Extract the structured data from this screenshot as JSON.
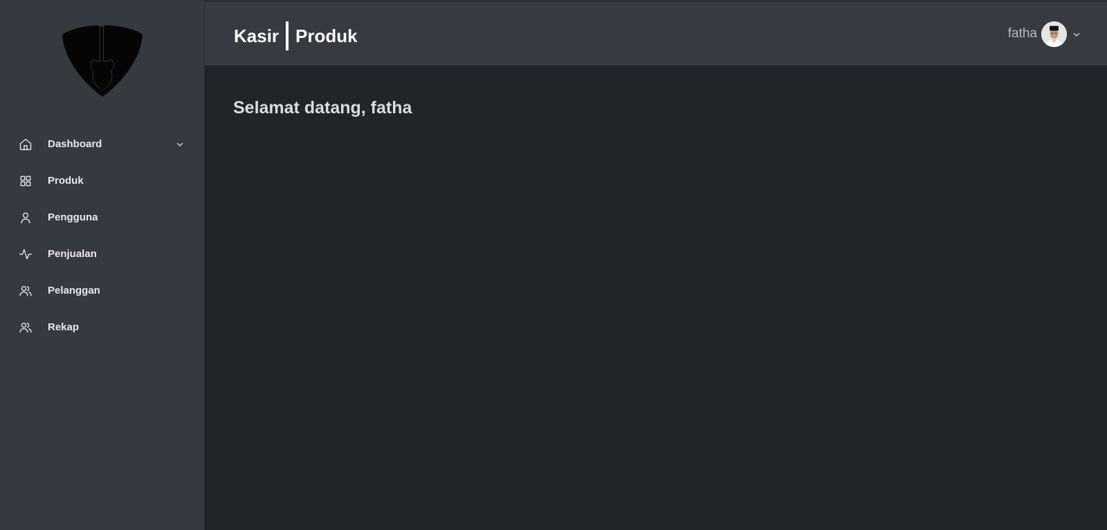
{
  "header": {
    "app_title": "Kasir",
    "page_title": "Produk",
    "user_name": "fatha"
  },
  "sidebar": {
    "items": [
      {
        "label": "Dashboard",
        "icon": "home-icon",
        "has_submenu": true
      },
      {
        "label": "Produk",
        "icon": "grid-icon"
      },
      {
        "label": "Pengguna",
        "icon": "user-icon"
      },
      {
        "label": "Penjualan",
        "icon": "activity-icon"
      },
      {
        "label": "Pelanggan",
        "icon": "users-icon"
      },
      {
        "label": "Rekap",
        "icon": "users-icon"
      }
    ]
  },
  "main": {
    "welcome_text": "Selamat datang, fatha"
  }
}
